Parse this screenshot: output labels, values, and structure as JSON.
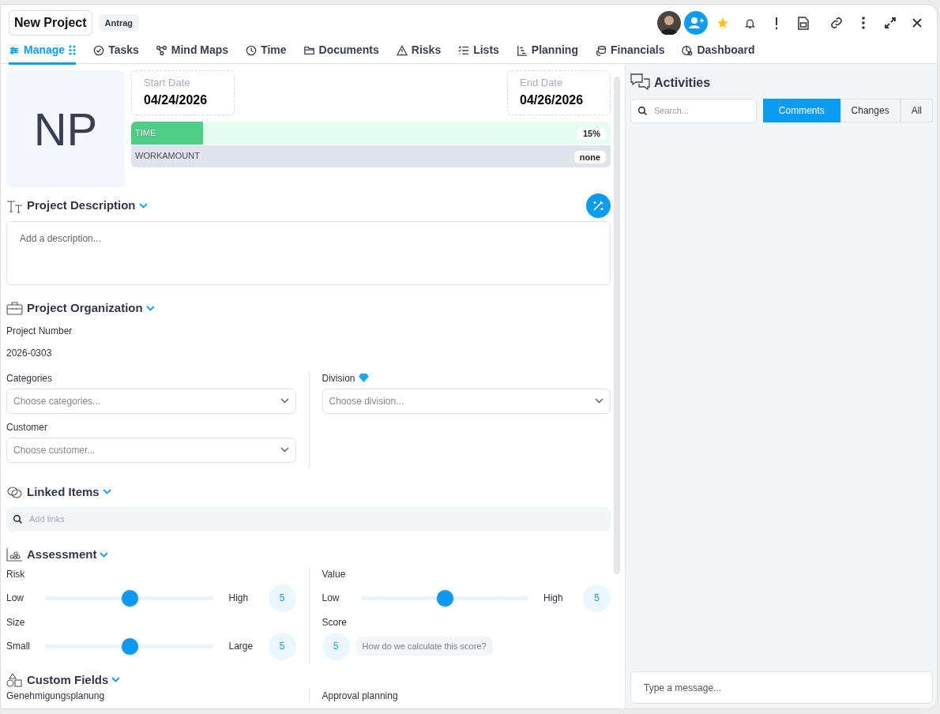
{
  "project": {
    "title": "New Project",
    "status": "Antrag",
    "initials": "NP"
  },
  "tabs": [
    {
      "label": "Manage",
      "selected": true
    },
    {
      "label": "Tasks",
      "selected": false
    },
    {
      "label": "Mind Maps",
      "selected": false
    },
    {
      "label": "Time",
      "selected": false
    },
    {
      "label": "Documents",
      "selected": false
    },
    {
      "label": "Risks",
      "selected": false
    },
    {
      "label": "Lists",
      "selected": false
    },
    {
      "label": "Planning",
      "selected": false
    },
    {
      "label": "Financials",
      "selected": false
    },
    {
      "label": "Dashboard",
      "selected": false
    }
  ],
  "dates": [
    {
      "label": "Start Date",
      "value": "04/24/2026"
    },
    {
      "label": "End Date",
      "value": "04/26/2026"
    }
  ],
  "progress": [
    {
      "label": "TIME",
      "level": 0.15,
      "reading": "15%"
    },
    {
      "label": "WORKAMOUNT",
      "level": 0,
      "reading": "none"
    }
  ],
  "description": {
    "title": "Project Description",
    "placeholder": "Add a description..."
  },
  "organization": {
    "title": "Project Organization",
    "number_label": "Project Number",
    "number": "2026-0303",
    "fields": [
      {
        "label": "Categories",
        "placeholder": "Choose categories..."
      },
      {
        "label": "Customer",
        "placeholder": "Choose customer..."
      },
      {
        "label": "Division",
        "placeholder": "Choose division...",
        "premium": true
      }
    ]
  },
  "linked": {
    "title": "Linked Items",
    "placeholder": "Add links"
  },
  "assessment": {
    "title": "Assessment",
    "sliders": [
      {
        "label": "Risk",
        "low": "Low",
        "high": "High",
        "level": 0.5,
        "reading": "5"
      },
      {
        "label": "Value",
        "low": "Low",
        "high": "High",
        "level": 0.5,
        "reading": "5"
      },
      {
        "label": "Size",
        "low": "Small",
        "high": "Large",
        "level": 0.5,
        "reading": "5"
      }
    ],
    "score": {
      "label": "Score",
      "value": "5",
      "help": "How do we calculate this score?"
    }
  },
  "custom_fields": {
    "title": "Custom Fields",
    "labels": [
      "Genehmigungsplanung",
      "Approval planning"
    ]
  },
  "activities": {
    "title": "Activities",
    "search_placeholder": "Search...",
    "filters": [
      {
        "label": "Comments",
        "selected": true
      },
      {
        "label": "Changes",
        "selected": false
      },
      {
        "label": "All",
        "selected": false
      }
    ],
    "message_placeholder": "Type a message..."
  }
}
